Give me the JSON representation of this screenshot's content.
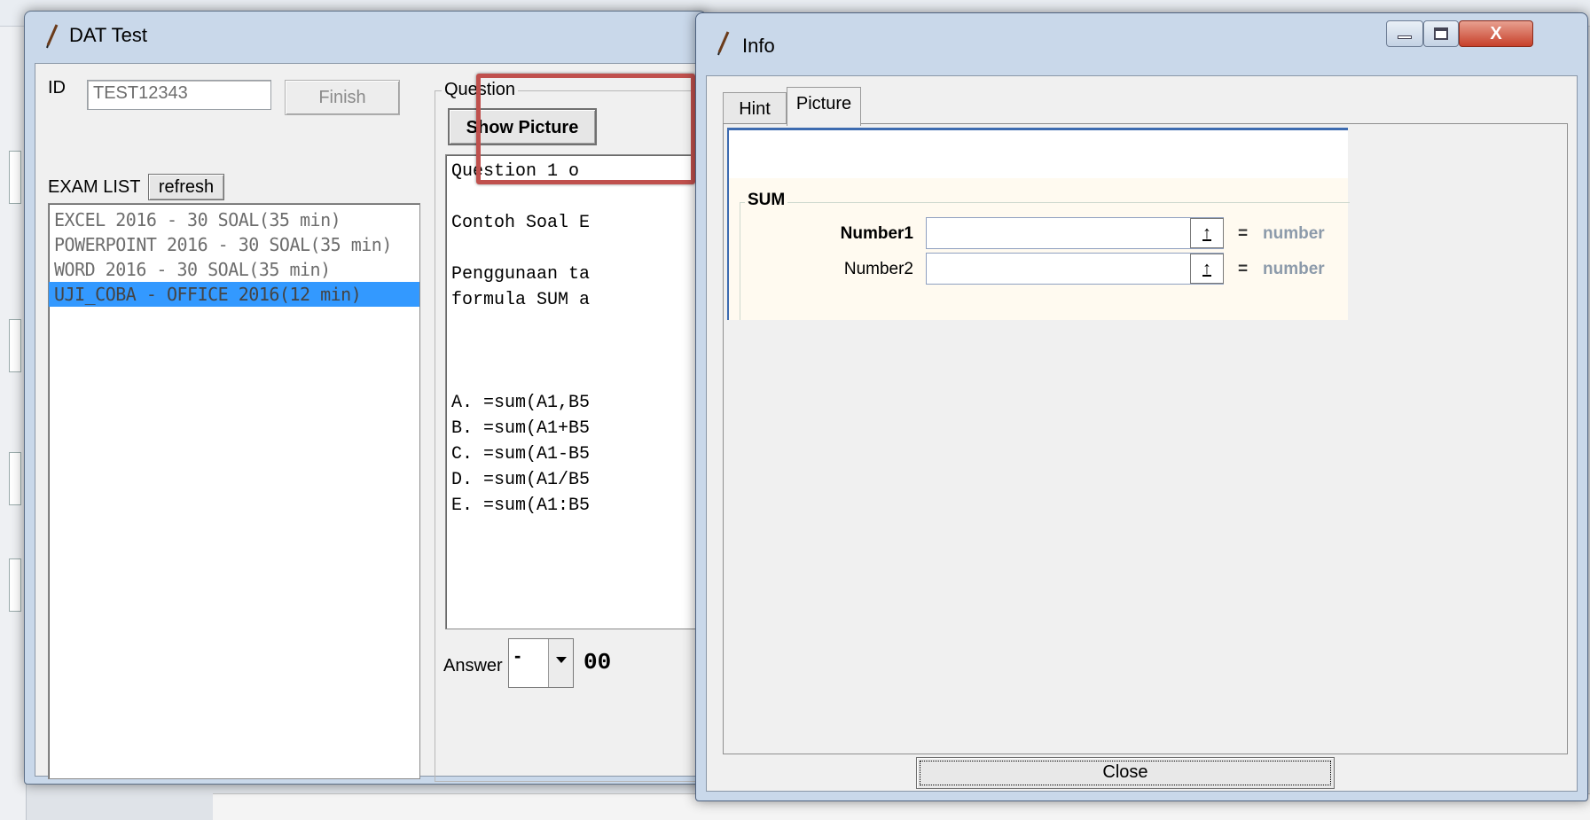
{
  "dat_window": {
    "title": "DAT Test",
    "id_label": "ID",
    "id_value": "TEST12343",
    "finish_label": "Finish",
    "exam_list_label": "EXAM LIST",
    "refresh_label": "refresh",
    "exam_list": [
      {
        "label": "EXCEL 2016 - 30 SOAL(35 min)"
      },
      {
        "label": "POWERPOINT 2016 - 30 SOAL(35 min)"
      },
      {
        "label": "WORD 2016 - 30 SOAL(35 min)"
      },
      {
        "label": "UJI_COBA - OFFICE 2016(12 min)"
      }
    ],
    "selected_exam_index": 3,
    "question_group_label": "Question",
    "show_picture_label": "Show Picture",
    "question_text": "Question 1 o\n\nContoh Soal E\n\nPenggunaan ta\nformula SUM a\n\n\n\nA. =sum(A1,B5\nB. =sum(A1+B5\nC. =sum(A1-B5\nD. =sum(A1/B5\nE. =sum(A1:B5",
    "answer_label": "Answer",
    "answer_value": "-",
    "timer_partial": "00"
  },
  "info_window": {
    "title": "Info",
    "tabs": [
      {
        "label": "Hint",
        "active": false
      },
      {
        "label": "Picture",
        "active": true
      }
    ],
    "picture": {
      "group_label": "SUM",
      "args": [
        {
          "label": "Number1",
          "button": "↑",
          "eq": "=",
          "hint": "number"
        },
        {
          "label": "Number2",
          "button": "↑",
          "eq": "=",
          "hint": "number"
        }
      ]
    },
    "close_label": "Close",
    "close_x": "X"
  },
  "colors": {
    "highlight_border": "#c0504d",
    "selection": "#3399ff",
    "window_frame": "#c9d8ea"
  }
}
